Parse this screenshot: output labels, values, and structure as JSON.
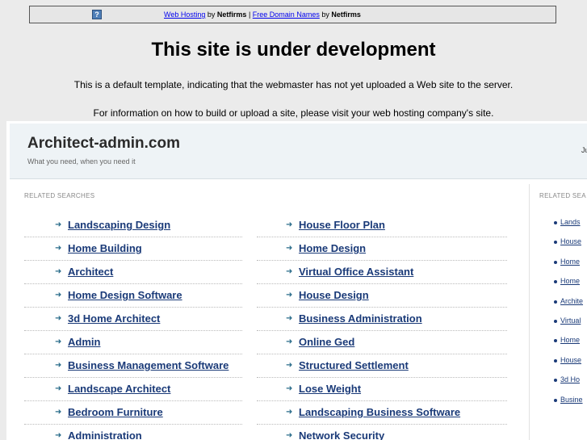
{
  "topbar": {
    "link1": "Web Hosting",
    "by1": "by",
    "brand1": "Netfirms",
    "sep": "|",
    "link2": "Free Domain Names",
    "by2": "by",
    "brand2": "Netfirms"
  },
  "notice": {
    "title": "This site is under development",
    "text1": "This is a default template, indicating that the webmaster has not yet uploaded a Web site to the server.",
    "text2": "For information on how to build or upload a site, please visit your web hosting company's site."
  },
  "site": {
    "title": "Architect-admin.com",
    "tagline": "What you need, when you need it",
    "header_right": "Ju"
  },
  "related": {
    "label_left": "RELATED SEARCHES",
    "label_right": "RELATED SEA",
    "col1": [
      "Landscaping Design",
      "Home Building",
      "Architect",
      "Home Design Software",
      "3d Home Architect",
      "Admin",
      "Business Management Software",
      "Landscape Architect",
      "Bedroom Furniture",
      "Administration"
    ],
    "col2": [
      "House Floor Plan",
      "Home Design",
      "Virtual Office Assistant",
      "House Design",
      "Business Administration",
      "Online Ged",
      "Structured Settlement",
      "Lose Weight",
      "Landscaping Business Software",
      "Network Security"
    ],
    "side": [
      "Lands",
      "House",
      "Home",
      "Home",
      "Archite",
      "Virtual",
      "Home",
      "House",
      "3d Ho",
      "Busine"
    ]
  }
}
